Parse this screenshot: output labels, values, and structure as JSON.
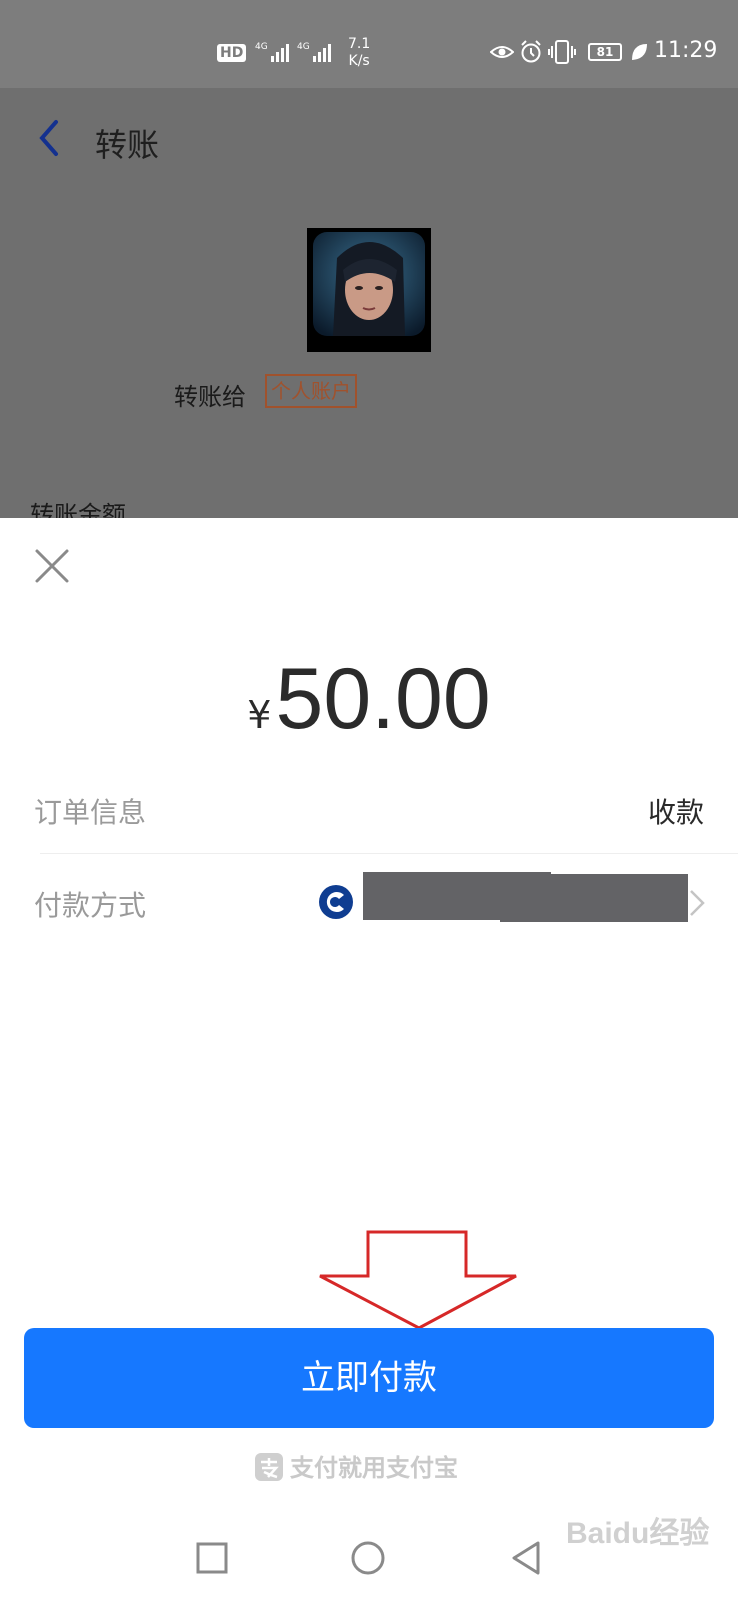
{
  "status_bar": {
    "hd": "HD",
    "net_4g_1": "4G",
    "net_4g_2": "4G",
    "speed_value": "7.1",
    "speed_unit": "K/s",
    "battery": "81",
    "time": "11:29"
  },
  "page": {
    "title": "转账",
    "transfer_to": "转账给",
    "account_badge": "个人账户",
    "amount_label": "转账金额"
  },
  "sheet": {
    "currency": "¥",
    "amount": "50.00",
    "order_label": "订单信息",
    "order_value": "收款",
    "payment_label": "付款方式"
  },
  "pay_button": "立即付款",
  "brand_slogan": "支付就用支付宝",
  "watermark": "Baidu经验",
  "colors": {
    "primary": "#1678ff",
    "status_bar": "#7d7d7d",
    "dim_overlay": "#6f6f6f",
    "badge": "#a0522d",
    "annotation_arrow": "#d62828"
  },
  "icons": [
    "back-icon",
    "close-icon",
    "bank-icon",
    "chevron-right-icon",
    "alipay-icon",
    "nav-recents-icon",
    "nav-home-icon",
    "nav-back-icon"
  ]
}
